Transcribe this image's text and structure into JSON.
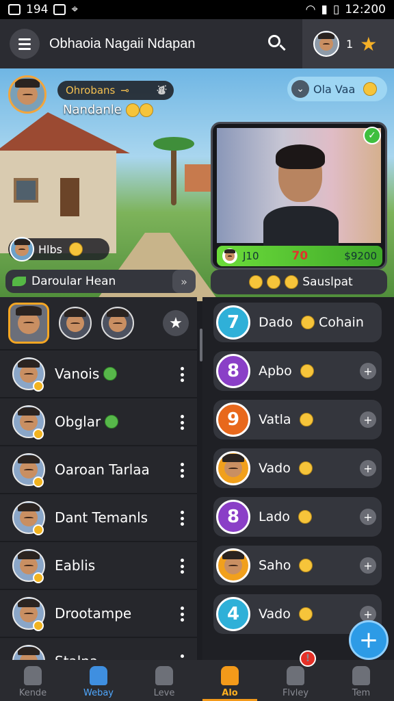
{
  "status_bar": {
    "left_text": "194",
    "time": "12:200"
  },
  "topbar": {
    "title": "Obhaoia Nagaii Ndapan",
    "level": "1"
  },
  "player": {
    "name": "Ohrobans",
    "subtitle": "Nandanle"
  },
  "chat_bubble": {
    "text": "Ola Vaa"
  },
  "video_call": {
    "left_value": "J10",
    "center_value": "70",
    "right_value": "$9200"
  },
  "hibs": {
    "label": "Hlbs"
  },
  "section_left": {
    "label": "Daroular Hean"
  },
  "section_right": {
    "label": "Sauslpat"
  },
  "left_list": [
    {
      "name": "Vanois"
    },
    {
      "name": "Obglar"
    },
    {
      "name": "Oaroan Tarlaa"
    },
    {
      "name": "Dant Temanls"
    },
    {
      "name": "Eablis"
    },
    {
      "name": "Drootampe"
    },
    {
      "name": "Stalna"
    }
  ],
  "right_list": [
    {
      "num": "7",
      "name": "Dado",
      "extra": "Cohain",
      "color": "#2fb0d8"
    },
    {
      "num": "8",
      "name": "Apbo",
      "extra": "",
      "color": "#8a3fc7"
    },
    {
      "num": "9",
      "name": "Vatla",
      "extra": "",
      "color": "#e8681c"
    },
    {
      "num": "",
      "name": "Vado",
      "extra": "",
      "color": "#f1a01c"
    },
    {
      "num": "8",
      "name": "Lado",
      "extra": "",
      "color": "#8a3fc7"
    },
    {
      "num": "",
      "name": "Saho",
      "extra": "",
      "color": "#f1a01c"
    },
    {
      "num": "4",
      "name": "Vado",
      "extra": "",
      "color": "#2fb0d8"
    }
  ],
  "nav": [
    {
      "label": "Kende",
      "icon": "home-icon"
    },
    {
      "label": "Webay",
      "icon": "shirt-icon"
    },
    {
      "label": "Leve",
      "icon": "trash-icon"
    },
    {
      "label": "Alo",
      "icon": "house-icon"
    },
    {
      "label": "Flvley",
      "icon": "map-icon",
      "alert": "!"
    },
    {
      "label": "Tem",
      "icon": "profile-icon"
    }
  ]
}
